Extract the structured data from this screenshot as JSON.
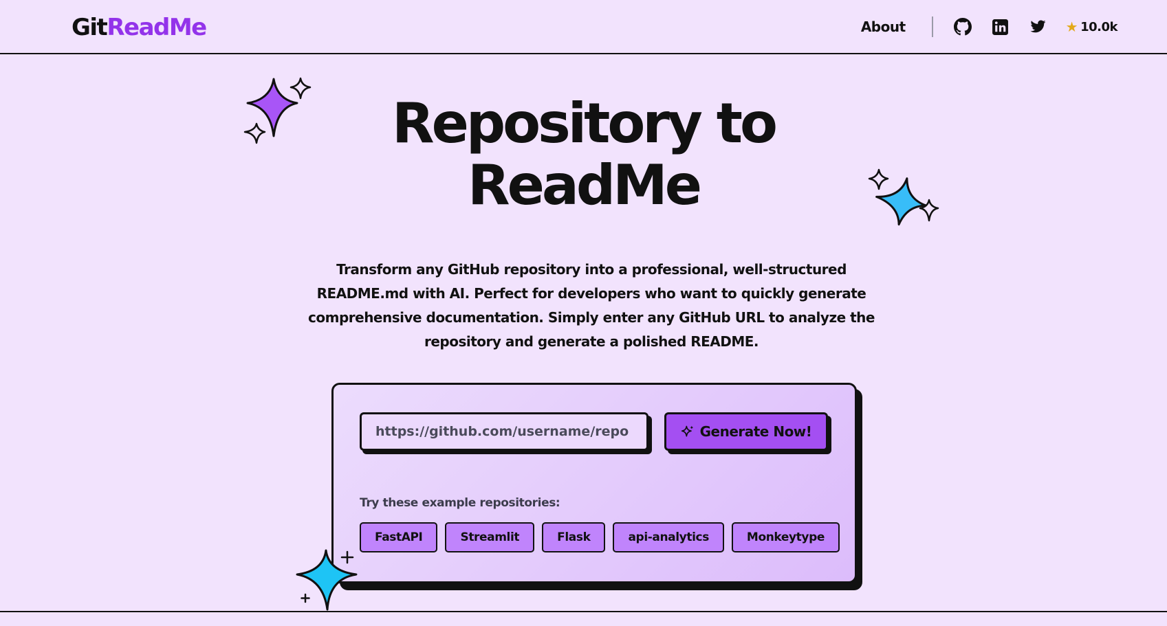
{
  "header": {
    "logo_part1": "Git",
    "logo_part2": "ReadMe",
    "about_label": "About",
    "social_icons": [
      "github-icon",
      "linkedin-icon",
      "twitter-icon"
    ],
    "star_icon": "star-icon",
    "star_count": "10.0k"
  },
  "hero": {
    "title_line1": "Repository to",
    "title_line2": "ReadMe",
    "description": "Transform any GitHub repository into a professional, well-structured README.md with AI. Perfect for developers who want to quickly generate comprehensive documentation. Simply enter any GitHub URL to analyze the repository and generate a polished README."
  },
  "form": {
    "url_placeholder": "https://github.com/username/repo",
    "generate_label": "Generate Now!",
    "examples_label": "Try these example repositories:",
    "examples": [
      "FastAPI",
      "Streamlit",
      "Flask",
      "api-analytics",
      "Monkeytype"
    ]
  },
  "colors": {
    "background": "#f2e3fd",
    "accent_purple": "#9333ea",
    "button_purple": "#a44ff2",
    "chip_purple": "#c084fc",
    "sparkle_blue": "#38bdf8",
    "star_gold": "#e3a91a"
  }
}
